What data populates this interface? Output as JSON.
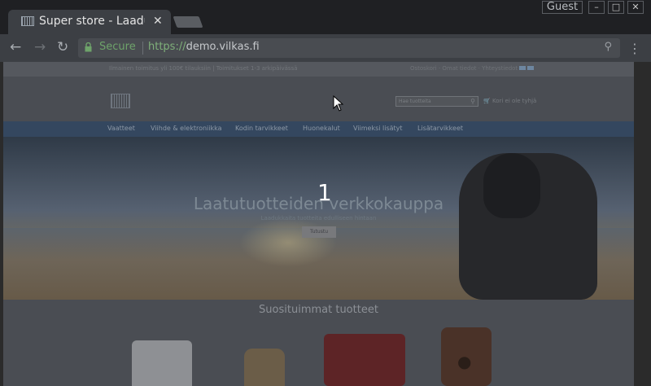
{
  "browser": {
    "tab": {
      "title": "Super store - Laadu",
      "close": "✕"
    },
    "guest_label": "Guest",
    "window_buttons": [
      "–",
      "□",
      "✕"
    ],
    "address": {
      "secure_label": "Secure",
      "scheme": "https://",
      "host": "demo.vilkas.fi"
    }
  },
  "page": {
    "topbar": {
      "left_text": "Ilmainen toimitus yli 100€ tilauksiin | Toimitukset 1-3 arkipäivässä",
      "right_text": "Ostoskori · Omat tiedot · Yhteystiedot"
    },
    "header": {
      "search_placeholder": "Hae tuotteita",
      "cart_label": "Kori ei ole tyhjä"
    },
    "nav": [
      "Vaatteet",
      "Viihde & elektroniikka",
      "Kodin tarvikkeet",
      "Huonekalut",
      "Viimeksi lisätyt",
      "Lisätarvikkeet"
    ],
    "hero": {
      "title": "Laatutuotteiden verkkokauppa",
      "subtitle": "Laadukkaita tuotteita edulliseen hintaan",
      "button": "Tutustu",
      "slide_number": "1"
    },
    "section_title": "Suosituimmat tuotteet"
  },
  "colors": {
    "nav_bg": "#34475f",
    "secure_green": "#6ea36a"
  }
}
